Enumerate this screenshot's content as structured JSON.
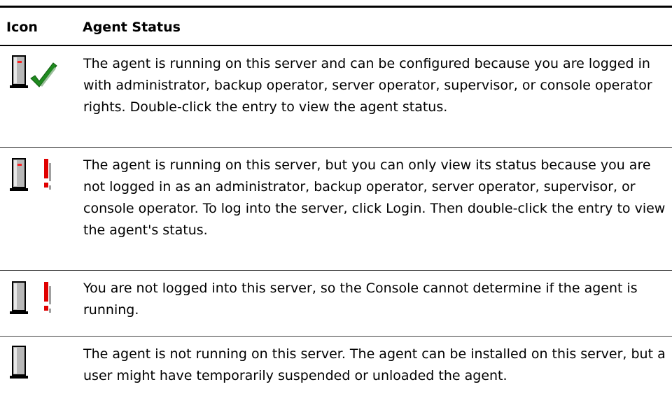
{
  "headers": {
    "icon": "Icon",
    "status": "Agent Status"
  },
  "rows": [
    {
      "icon": "server-check-icon",
      "text": "The agent is running on this server and can be configured because you are logged in with administrator, backup operator, server operator, supervisor, or console operator rights. Double-click the entry to view the agent status."
    },
    {
      "icon": "server-running-exclamation-icon",
      "text": "The agent is running on this server, but you can only view its status because you are not logged in as an administrator, backup operator, server operator, supervisor, or console operator. To log into the server, click Login. Then double-click the entry to view the agent's status."
    },
    {
      "icon": "server-exclamation-icon",
      "text": "You are not logged into this server, so the Console cannot determine if the agent is running."
    },
    {
      "icon": "server-icon",
      "text": "The agent is not running on this server. The agent can be installed on this server, but a user might have temporarily suspended or unloaded the agent."
    }
  ],
  "colors": {
    "check": "#1f8a1f",
    "exclamation": "#e00000",
    "led": "#ff2020",
    "server": "#b8b8b8"
  }
}
